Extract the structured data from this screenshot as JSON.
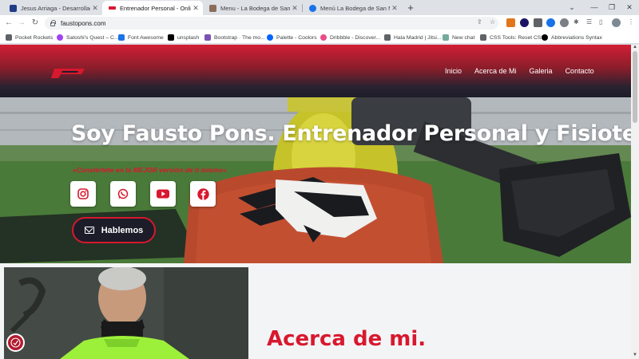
{
  "browser": {
    "tabs": [
      {
        "title": "Jesus Arriaga - Desarrollador Fro",
        "favicon_color": "#1f3c88",
        "active": false
      },
      {
        "title": "Entrenador Personal - Online - Fa",
        "favicon_color": "#d8182e",
        "active": true
      },
      {
        "title": "Menu - La Bodega de San Miguel",
        "favicon_color": "#8a6d5a",
        "active": false
      },
      {
        "title": "Menú La Bodega de San Miguel",
        "favicon_color": "#1a73e8",
        "active": false
      }
    ],
    "new_tab_label": "+",
    "window_controls": [
      "⌄",
      "—",
      "❐",
      "✕"
    ],
    "url": "faustopons.com",
    "bookmarks": [
      {
        "label": "Pocket Rockets",
        "color": "#5f6368"
      },
      {
        "label": "Satoshi's Quest – C...",
        "color": "#a142f4"
      },
      {
        "label": "Font Awesome",
        "color": "#1a73e8"
      },
      {
        "label": "unsplash",
        "color": "#000000"
      },
      {
        "label": "Bootstrap · The mo...",
        "color": "#7952b3"
      },
      {
        "label": "Palette - Coolors",
        "color": "#0066ff"
      },
      {
        "label": "Dribbble - Discover...",
        "color": "#ea4c89"
      },
      {
        "label": "Hala Madrid | Jitsi...",
        "color": "#5f6368"
      },
      {
        "label": "New chat",
        "color": "#74aa9c"
      },
      {
        "label": "CSS Tools: Reset CSS",
        "color": "#5f6368"
      },
      {
        "label": "Abbreviations Syntax",
        "color": "#000000"
      }
    ]
  },
  "site": {
    "nav": [
      "Inicio",
      "Acerca de Mi",
      "Galeria",
      "Contacto"
    ],
    "hero_title": "Soy Fausto Pons. Entrenador Personal y Fisioterapeuta",
    "hero_subtitle": "«Conviértete en la MEJOR versión de ti mismo»",
    "social_icons": [
      "instagram-icon",
      "whatsapp-icon",
      "youtube-icon",
      "facebook-icon"
    ],
    "cta_label": "Hablemos",
    "about_title": "Acerca de mi.",
    "colors": {
      "accent": "#d8182e",
      "dark": "#1c1d29"
    }
  }
}
